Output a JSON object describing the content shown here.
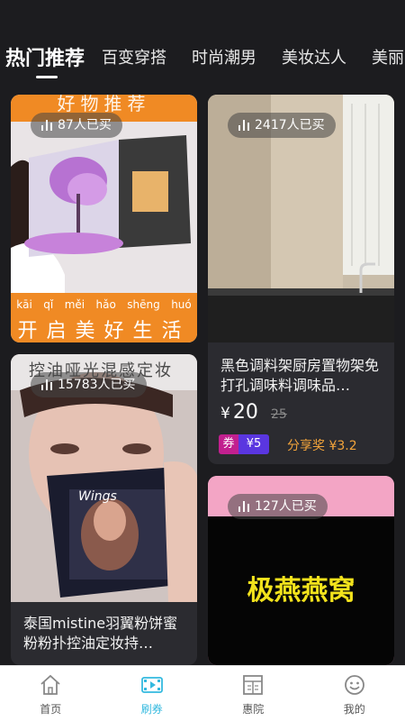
{
  "tabs": [
    {
      "label": "热门推荐",
      "active": true
    },
    {
      "label": "百变穿搭"
    },
    {
      "label": "时尚潮男"
    },
    {
      "label": "美妆达人"
    },
    {
      "label": "美丽"
    }
  ],
  "cards": [
    {
      "sold": "87人已买",
      "banner_pinyin": [
        "kāi",
        "qǐ",
        "měi",
        "hǎo",
        "shēng",
        "huó"
      ],
      "banner_text": "开启美好生活",
      "top_text": "好物推荐"
    },
    {
      "sold": "2417人已买",
      "title": "黑色调料架厨房置物架免打孔调味料调味品…",
      "price_symbol": "¥",
      "price": "20",
      "orig_price": "25",
      "coupon_label": "券",
      "coupon_value": "¥5",
      "share_text": "分享奖 ¥3.2"
    },
    {
      "sold": "15783人已买",
      "top_text": "控油哑光混感定妆",
      "product_brand": "Wings",
      "title": "泰国mistine羽翼粉饼蜜粉粉扑控油定妆持…"
    },
    {
      "sold": "127人已买",
      "banner_text": "极燕燕窝"
    }
  ],
  "bottom_nav": [
    {
      "label": "首页",
      "icon": "home-icon"
    },
    {
      "label": "刷券",
      "icon": "film-icon",
      "active": true
    },
    {
      "label": "惠院",
      "icon": "theater-icon"
    },
    {
      "label": "我的",
      "icon": "smiley-icon"
    }
  ],
  "colors": {
    "accent": "#33b9df",
    "coupon_left": "#c2208f",
    "coupon_right": "#5a36e0",
    "share": "#f3a43b",
    "banner_orange": "#f08a24"
  }
}
